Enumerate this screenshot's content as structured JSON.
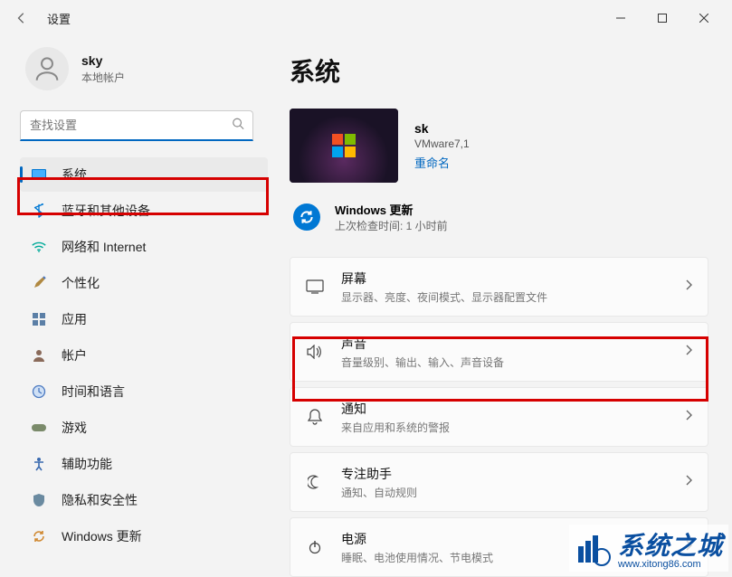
{
  "window": {
    "title": "设置"
  },
  "user": {
    "name": "sky",
    "type": "本地帐户"
  },
  "search": {
    "placeholder": "查找设置"
  },
  "sidebar": {
    "items": [
      {
        "label": "系统"
      },
      {
        "label": "蓝牙和其他设备"
      },
      {
        "label": "网络和 Internet"
      },
      {
        "label": "个性化"
      },
      {
        "label": "应用"
      },
      {
        "label": "帐户"
      },
      {
        "label": "时间和语言"
      },
      {
        "label": "游戏"
      },
      {
        "label": "辅助功能"
      },
      {
        "label": "隐私和安全性"
      },
      {
        "label": "Windows 更新"
      }
    ]
  },
  "page": {
    "title": "系统"
  },
  "device": {
    "name": "sk",
    "model": "VMware7,1",
    "rename": "重命名"
  },
  "update": {
    "title": "Windows 更新",
    "sub": "上次检查时间: 1 小时前"
  },
  "cards": [
    {
      "title": "屏幕",
      "sub": "显示器、亮度、夜间模式、显示器配置文件"
    },
    {
      "title": "声音",
      "sub": "音量级别、输出、输入、声音设备"
    },
    {
      "title": "通知",
      "sub": "来自应用和系统的警报"
    },
    {
      "title": "专注助手",
      "sub": "通知、自动规则"
    },
    {
      "title": "电源",
      "sub": "睡眠、电池使用情况、节电模式"
    }
  ],
  "watermark": {
    "text": "系统之城",
    "url": "www.xitong86.com"
  }
}
